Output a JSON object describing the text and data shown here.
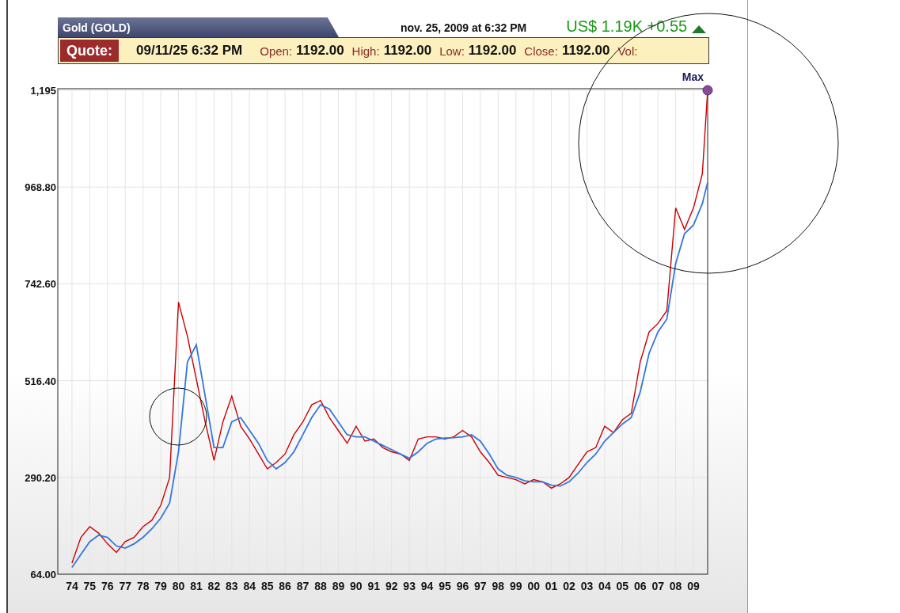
{
  "title_tab": "Gold (GOLD)",
  "timestamp": "nov. 25, 2009 at 6:32 PM",
  "price_change": {
    "text": "US$ 1.19K +0.55",
    "rising": true
  },
  "quote_bar": {
    "label": "Quote:",
    "datetime": "09/11/25 6:32 PM",
    "fields": [
      {
        "label": "Open:",
        "value": "1192.00"
      },
      {
        "label": "High:",
        "value": "1192.00"
      },
      {
        "label": "Low:",
        "value": "1192.00"
      },
      {
        "label": "Close:",
        "value": "1192.00"
      },
      {
        "label": "Vol:"
      }
    ]
  },
  "chart": {
    "max_marker": {
      "label": "Max"
    },
    "chart_data": {
      "type": "line",
      "grid": true,
      "xlim": [
        1973.2,
        2009.8
      ],
      "ylim": [
        64,
        1195
      ],
      "x": [
        1974,
        1974.5,
        1975,
        1975.5,
        1976,
        1976.5,
        1977,
        1977.5,
        1978,
        1978.5,
        1979,
        1979.5,
        1980,
        1980.5,
        1981,
        1981.5,
        1982,
        1982.5,
        1983,
        1983.5,
        1984,
        1984.5,
        1985,
        1985.5,
        1986,
        1986.5,
        1987,
        1987.5,
        1988,
        1988.5,
        1989,
        1989.5,
        1990,
        1990.5,
        1991,
        1991.5,
        1992,
        1992.5,
        1993,
        1993.5,
        1994,
        1994.5,
        1995,
        1995.5,
        1996,
        1996.5,
        1997,
        1997.5,
        1998,
        1998.5,
        1999,
        1999.5,
        2000,
        2000.5,
        2001,
        2001.5,
        2002,
        2002.5,
        2003,
        2003.5,
        2004,
        2004.5,
        2005,
        2005.5,
        2006,
        2006.5,
        2007,
        2007.5,
        2008,
        2008.5,
        2009,
        2009.5,
        2009.8
      ],
      "series": [
        {
          "color": "#cc0000",
          "values": [
            90,
            150,
            175,
            160,
            135,
            115,
            140,
            150,
            175,
            190,
            225,
            290,
            700,
            620,
            520,
            420,
            330,
            420,
            480,
            410,
            380,
            345,
            310,
            325,
            345,
            390,
            420,
            460,
            470,
            430,
            400,
            370,
            410,
            375,
            380,
            360,
            350,
            345,
            330,
            380,
            385,
            385,
            380,
            385,
            400,
            385,
            350,
            325,
            295,
            290,
            285,
            275,
            285,
            280,
            265,
            275,
            290,
            320,
            350,
            360,
            410,
            395,
            425,
            440,
            560,
            630,
            650,
            680,
            920,
            870,
            920,
            1000,
            1195
          ]
        },
        {
          "color": "#3377dd",
          "values": [
            80,
            110,
            140,
            155,
            150,
            130,
            125,
            135,
            150,
            170,
            195,
            230,
            350,
            560,
            600,
            480,
            360,
            360,
            420,
            430,
            400,
            370,
            330,
            310,
            325,
            350,
            390,
            430,
            460,
            450,
            420,
            390,
            385,
            385,
            375,
            365,
            355,
            345,
            335,
            350,
            370,
            380,
            382,
            383,
            385,
            390,
            375,
            345,
            310,
            295,
            290,
            282,
            280,
            280,
            272,
            270,
            280,
            300,
            325,
            345,
            375,
            395,
            415,
            430,
            490,
            580,
            630,
            660,
            790,
            860,
            880,
            930,
            980
          ]
        }
      ],
      "yticks": [
        {
          "value": 1195,
          "label": "1,195"
        },
        {
          "value": 968.8,
          "label": "968.80"
        },
        {
          "value": 742.6,
          "label": "742.60"
        },
        {
          "value": 516.4,
          "label": "516.40"
        },
        {
          "value": 290.2,
          "label": "290.20"
        },
        {
          "value": 64,
          "label": "64.00"
        }
      ],
      "xticks": [
        {
          "value": 1974,
          "label": "74"
        },
        {
          "value": 1975,
          "label": "75"
        },
        {
          "value": 1976,
          "label": "76"
        },
        {
          "value": 1977,
          "label": "77"
        },
        {
          "value": 1978,
          "label": "78"
        },
        {
          "value": 1979,
          "label": "79"
        },
        {
          "value": 1980,
          "label": "80"
        },
        {
          "value": 1981,
          "label": "81"
        },
        {
          "value": 1982,
          "label": "82"
        },
        {
          "value": 1983,
          "label": "83"
        },
        {
          "value": 1984,
          "label": "84"
        },
        {
          "value": 1985,
          "label": "85"
        },
        {
          "value": 1986,
          "label": "86"
        },
        {
          "value": 1987,
          "label": "87"
        },
        {
          "value": 1988,
          "label": "88"
        },
        {
          "value": 1989,
          "label": "89"
        },
        {
          "value": 1990,
          "label": "90"
        },
        {
          "value": 1991,
          "label": "91"
        },
        {
          "value": 1992,
          "label": "92"
        },
        {
          "value": 1993,
          "label": "93"
        },
        {
          "value": 1994,
          "label": "94"
        },
        {
          "value": 1995,
          "label": "95"
        },
        {
          "value": 1996,
          "label": "96"
        },
        {
          "value": 1997,
          "label": "97"
        },
        {
          "value": 1998,
          "label": "98"
        },
        {
          "value": 1999,
          "label": "99"
        },
        {
          "value": 2000,
          "label": "00"
        },
        {
          "value": 2001,
          "label": "01"
        },
        {
          "value": 2002,
          "label": "02"
        },
        {
          "value": 2003,
          "label": "03"
        },
        {
          "value": 2004,
          "label": "04"
        },
        {
          "value": 2005,
          "label": "05"
        },
        {
          "value": 2006,
          "label": "06"
        },
        {
          "value": 2007,
          "label": "07"
        },
        {
          "value": 2008,
          "label": "08"
        },
        {
          "value": 2009,
          "label": "09"
        }
      ]
    }
  }
}
